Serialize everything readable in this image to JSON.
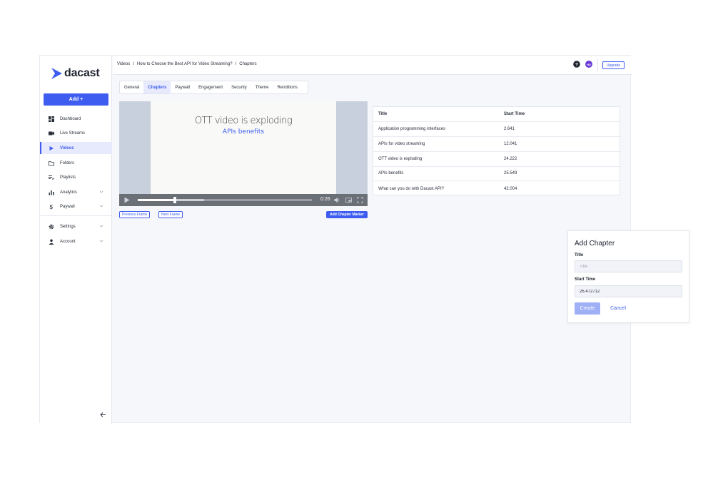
{
  "brand": {
    "name": "dacast",
    "accent": "#3e5df0"
  },
  "sidebar": {
    "add_label": "Add +",
    "items": [
      {
        "label": "Dashboard",
        "icon": "dashboard-icon"
      },
      {
        "label": "Live Streams",
        "icon": "camera-icon"
      },
      {
        "label": "Videos",
        "icon": "play-icon",
        "active": true
      },
      {
        "label": "Folders",
        "icon": "folder-icon"
      },
      {
        "label": "Playlists",
        "icon": "playlist-icon"
      },
      {
        "label": "Analytics",
        "icon": "analytics-icon"
      },
      {
        "label": "Paywall",
        "icon": "dollar-icon"
      },
      {
        "label": "Settings",
        "icon": "gear-icon"
      },
      {
        "label": "Account",
        "icon": "person-icon"
      }
    ]
  },
  "header": {
    "breadcrumb": [
      "Videos",
      "/",
      "How to Choose the Best API for Video Streaming?",
      "/",
      "Chapters"
    ],
    "avatar_initials": "HD",
    "upgrade_label": "Upgrade"
  },
  "tabs": [
    "General",
    "Chapters",
    "Paywall",
    "Engagement",
    "Security",
    "Theme",
    "Renditions"
  ],
  "active_tab": "Chapters",
  "player": {
    "slide_title": "OTT video is exploding",
    "slide_subtitle": "APIs benefits",
    "time": "0:26",
    "played_fraction": 0.215,
    "buffered_fraction": 0.38
  },
  "controls": {
    "previous_frame": "Previous Frame",
    "next_frame": "Next Frame",
    "add_marker": "Add Chapter Marker"
  },
  "chapters_table": {
    "headers": {
      "title": "Title",
      "start_time": "Start Time"
    },
    "rows": [
      {
        "title": "Application programming interfaces",
        "start_time": "2.641"
      },
      {
        "title": "APIs for video streaming",
        "start_time": "12.041"
      },
      {
        "title": "OTT video is exploding",
        "start_time": "24.222"
      },
      {
        "title": "APIs benefits",
        "start_time": "25.549"
      },
      {
        "title": "What can you do with Dacast API?",
        "start_time": "42.004"
      }
    ]
  },
  "add_chapter": {
    "heading": "Add Chapter",
    "title_label": "Title",
    "title_placeholder": "Title",
    "title_value": "",
    "start_label": "Start Time",
    "start_value": "26.472712",
    "create_label": "Create",
    "cancel_label": "Cancel"
  }
}
